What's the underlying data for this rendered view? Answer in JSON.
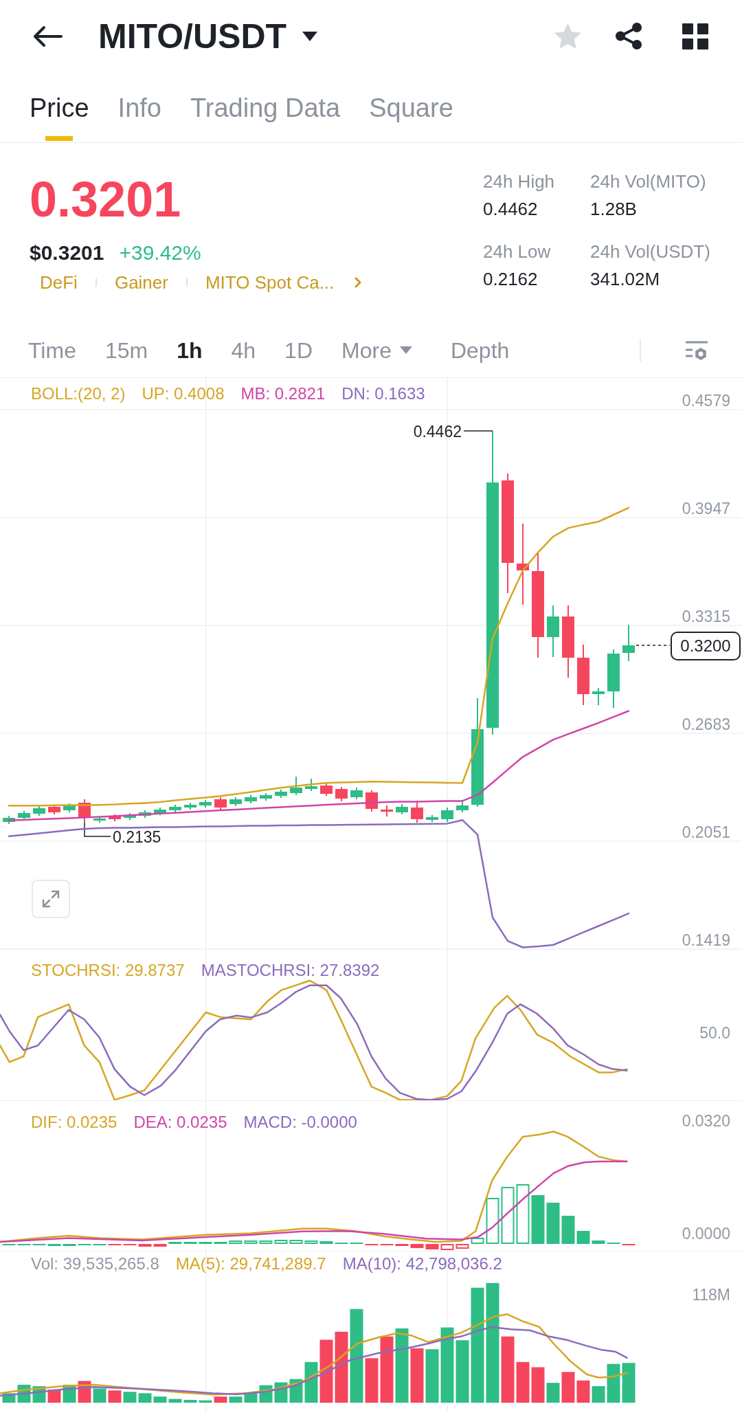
{
  "header": {
    "title": "MITO/USDT",
    "favorite": false
  },
  "tabs": [
    {
      "label": "Price",
      "selected": true
    },
    {
      "label": "Info",
      "selected": false
    },
    {
      "label": "Trading Data",
      "selected": false
    },
    {
      "label": "Square",
      "selected": false
    }
  ],
  "ticker": {
    "price": "0.3201",
    "rising": false,
    "usd_price": "$0.3201",
    "change": "+39.42%",
    "change_positive": true,
    "tags": [
      "DeFi",
      "Gainer",
      "MITO Spot Ca..."
    ]
  },
  "stats": [
    {
      "label": "24h High",
      "value": "0.4462"
    },
    {
      "label": "24h Vol(MITO)",
      "value": "1.28B"
    },
    {
      "label": "24h Low",
      "value": "0.2162"
    },
    {
      "label": "24h Vol(USDT)",
      "value": "341.02M"
    }
  ],
  "intervals": [
    {
      "label": "Time",
      "kind": "interval",
      "selected": false
    },
    {
      "label": "15m",
      "kind": "interval",
      "selected": false
    },
    {
      "label": "1h",
      "kind": "interval",
      "selected": true
    },
    {
      "label": "4h",
      "kind": "interval",
      "selected": false
    },
    {
      "label": "1D",
      "kind": "interval",
      "selected": false
    },
    {
      "label": "More",
      "kind": "dropdown",
      "selected": false
    },
    {
      "label": "Depth",
      "kind": "interval",
      "selected": false
    }
  ],
  "price_chart": {
    "high_label": "0.4462",
    "low_label": "0.2135",
    "last_price": "0.3200",
    "chart_data": {
      "type": "line",
      "title": "BOLL:(20, 2)",
      "grid": true,
      "ylim": [
        0.1419,
        0.4579
      ],
      "yticks": [
        0.4579,
        0.3947,
        0.3315,
        0.2683,
        0.2051,
        0.1419
      ],
      "series": [
        {
          "name": "UP: 0.4008",
          "color": "#d6a624",
          "values": [
            0.2259,
            0.2259,
            0.2259,
            0.2261,
            0.2262,
            0.2262,
            0.2263,
            0.2266,
            0.2271,
            0.2275,
            0.228,
            0.229,
            0.2298,
            0.2307,
            0.2316,
            0.2327,
            0.2339,
            0.2352,
            0.2364,
            0.2374,
            0.2384,
            0.2392,
            0.2395,
            0.2397,
            0.24,
            0.2399,
            0.2397,
            0.2396,
            0.2395,
            0.2393,
            0.2392,
            0.263,
            0.3239,
            0.3445,
            0.3636,
            0.3742,
            0.3835,
            0.3885,
            0.3905,
            0.3923,
            0.3963,
            0.4004
          ]
        },
        {
          "name": "MB: 0.2821",
          "color": "#cf45a9",
          "values": [
            0.2173,
            0.2176,
            0.218,
            0.2183,
            0.2186,
            0.219,
            0.2194,
            0.2198,
            0.2203,
            0.2208,
            0.2213,
            0.2217,
            0.2222,
            0.2227,
            0.2232,
            0.2236,
            0.2241,
            0.2246,
            0.225,
            0.2255,
            0.2259,
            0.2264,
            0.2268,
            0.2273,
            0.2277,
            0.228,
            0.2282,
            0.2283,
            0.2284,
            0.2286,
            0.2287,
            0.2322,
            0.2394,
            0.247,
            0.2545,
            0.2595,
            0.2645,
            0.2678,
            0.2711,
            0.2744,
            0.2779,
            0.2814
          ]
        },
        {
          "name": "DN: 0.1633",
          "color": "#8b6bbd",
          "values": [
            0.208,
            0.2088,
            0.2097,
            0.2106,
            0.2115,
            0.2123,
            0.2127,
            0.2129,
            0.213,
            0.2131,
            0.2133,
            0.2134,
            0.2135,
            0.2137,
            0.2138,
            0.2139,
            0.2141,
            0.2142,
            0.2143,
            0.2144,
            0.2145,
            0.2146,
            0.2147,
            0.2148,
            0.2149,
            0.215,
            0.2151,
            0.2152,
            0.2153,
            0.2154,
            0.2175,
            0.209,
            0.1604,
            0.1467,
            0.1429,
            0.1435,
            0.1443,
            0.148,
            0.1517,
            0.1554,
            0.1591,
            0.1628
          ]
        }
      ]
    }
  },
  "stochrsi_chart": {
    "legend": [
      {
        "text": "STOCHRSI: 29.8737",
        "color": "#d6a624"
      },
      {
        "text": "MASTOCHRSI: 27.8392",
        "color": "#8b6bbd"
      }
    ],
    "axis": [
      "50.0"
    ]
  },
  "macd_chart": {
    "legend": [
      {
        "text": "DIF: 0.0235",
        "color": "#d6a624"
      },
      {
        "text": "DEA: 0.0235",
        "color": "#cf45a9"
      },
      {
        "text": "MACD: -0.0000",
        "color": "#8b6bbd"
      }
    ],
    "axis": [
      "0.0320",
      "0.0000"
    ]
  },
  "volume_chart": {
    "legend": [
      {
        "text": "Vol: 39,535,265.8",
        "color": "#929aa5"
      },
      {
        "text": "MA(5): 29,741,289.7",
        "color": "#d6a624"
      },
      {
        "text": "MA(10): 42,798,036.2",
        "color": "#8b6bbd"
      }
    ],
    "axis": [
      "118M"
    ]
  }
}
